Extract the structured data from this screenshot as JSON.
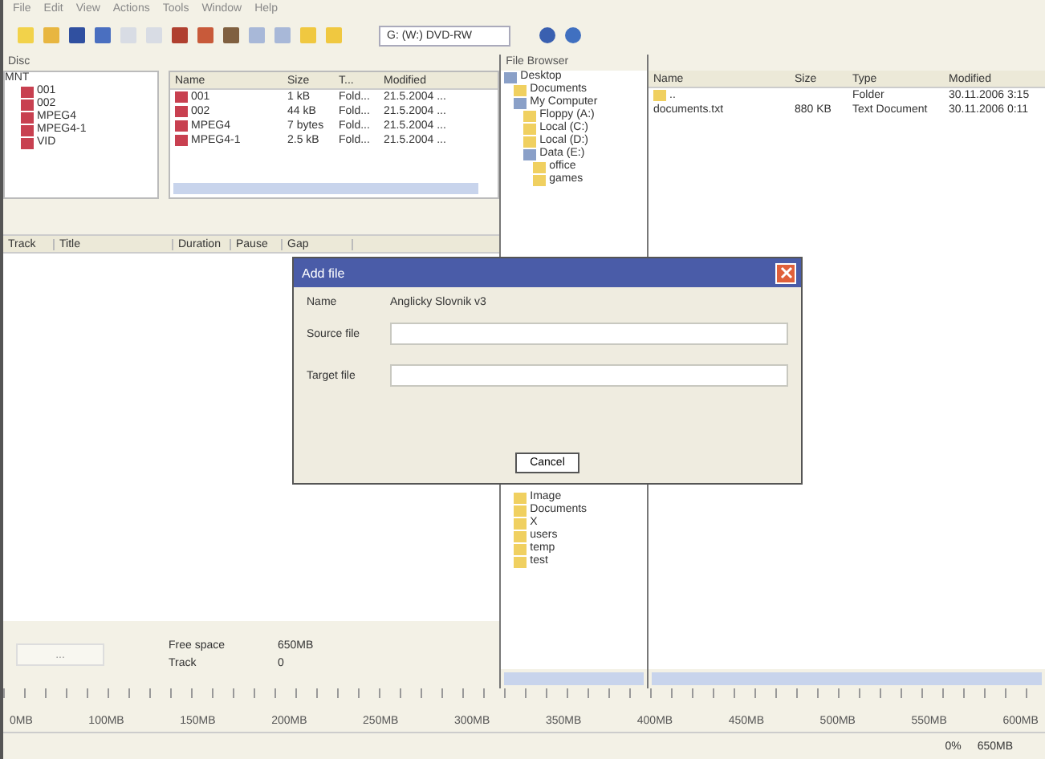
{
  "menu": [
    "File",
    "Edit",
    "View",
    "Actions",
    "Tools",
    "Window",
    "Help"
  ],
  "toolbar": {
    "buttons": [
      {
        "kind": "new"
      },
      {
        "kind": "open"
      },
      {
        "kind": "save"
      },
      {
        "kind": "add"
      },
      {
        "kind": "doc"
      },
      {
        "kind": "doc"
      },
      {
        "kind": "burn"
      },
      {
        "kind": "erase"
      },
      {
        "kind": "copy"
      },
      {
        "kind": "props"
      },
      {
        "kind": "props"
      },
      {
        "kind": "folder"
      },
      {
        "kind": "folder"
      }
    ],
    "drive": "G: (W:) DVD-RW",
    "extra": [
      {
        "kind": "info"
      },
      {
        "kind": "help"
      }
    ]
  },
  "left": {
    "title": "Disc",
    "tree": {
      "label": "MNT",
      "children": [
        {
          "label": "001"
        },
        {
          "label": "002"
        },
        {
          "label": "MPEG4"
        },
        {
          "label": "MPEG4-1"
        },
        {
          "label": "VID"
        }
      ]
    },
    "files": {
      "columns": [
        "Name",
        "Size",
        "T...",
        "Modified"
      ],
      "rows": [
        [
          "001",
          "1 kB",
          "Fold...",
          "21.5.2004 ..."
        ],
        [
          "002",
          "44 kB",
          "Fold...",
          "21.5.2004 ..."
        ],
        [
          "MPEG4",
          "7 bytes",
          "Fold...",
          "21.5.2004 ..."
        ],
        [
          "MPEG4-1",
          "2.5 kB",
          "Fold...",
          "21.5.2004 ..."
        ]
      ]
    },
    "tracks": {
      "columns": [
        "Track",
        "Title",
        "Duration",
        "Pause",
        "Gap"
      ]
    },
    "info": [
      {
        "label": "Free space",
        "value": "650MB"
      },
      {
        "label": "Track",
        "value": "0"
      }
    ],
    "button": "..."
  },
  "browser": {
    "title": "File Browser",
    "tree": [
      {
        "label": "Desktop",
        "children": [
          {
            "label": "Documents"
          },
          {
            "label": "My Computer",
            "children": [
              {
                "label": "Floppy (A:)"
              },
              {
                "label": "Local (C:)"
              },
              {
                "label": "Local (D:)"
              },
              {
                "label": "Data (E:)",
                "children": [
                  {
                    "label": "office"
                  },
                  {
                    "label": "games"
                  }
                ]
              }
            ]
          }
        ]
      }
    ],
    "tree_bottom": [
      {
        "label": "Image"
      },
      {
        "label": "Documents"
      },
      {
        "label": "X"
      },
      {
        "label": "users"
      },
      {
        "label": "temp"
      },
      {
        "label": "test"
      }
    ]
  },
  "right": {
    "columns": [
      "Name",
      "Size",
      "Type",
      "Modified"
    ],
    "rows": [
      {
        "kind": "folder",
        "cells": [
          "..",
          "",
          "Folder",
          "30.11.2006 3:15"
        ]
      },
      {
        "kind": "file",
        "cells": [
          "documents.txt",
          "880 KB",
          "Text Document",
          "30.11.2006 0:11"
        ]
      }
    ]
  },
  "ruler": [
    "0MB",
    "100MB",
    "150MB",
    "200MB",
    "250MB",
    "300MB",
    "350MB",
    "400MB",
    "450MB",
    "500MB",
    "550MB",
    "600MB"
  ],
  "status": [
    "0%",
    "650MB"
  ],
  "dialog": {
    "title": "Add file",
    "name_label": "Name",
    "name_value": "Anglicky Slovnik v3",
    "fields": [
      {
        "label": "Source file"
      },
      {
        "label": "Target file"
      }
    ],
    "button": "Cancel"
  }
}
